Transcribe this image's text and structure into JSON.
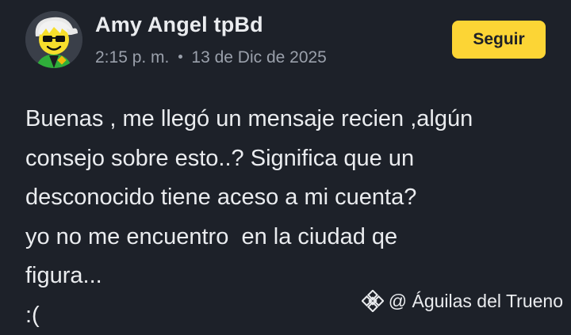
{
  "post": {
    "author": {
      "name": "Amy Angel tpBd",
      "avatar_icon": "cool-sunglasses-face-avatar"
    },
    "meta": {
      "time": "2:15 p. m.",
      "date": "13 de Dic de 2025"
    },
    "follow_label": "Seguir",
    "body_lines": [
      "Buenas , me llegó un mensaje recien ,algún",
      "consejo sobre esto..? Significa que un",
      "desconocido tiene aceso a mi cuenta?",
      "yo no me encuentro  en la ciudad qe",
      "figura...",
      ":("
    ]
  },
  "watermark": {
    "icon": "binance-logo-icon",
    "text": "@ Águilas del Trueno"
  },
  "colors": {
    "background": "#1d2129",
    "text": "#eaecef",
    "muted": "#9aa0ab",
    "accent": "#fcd535"
  }
}
